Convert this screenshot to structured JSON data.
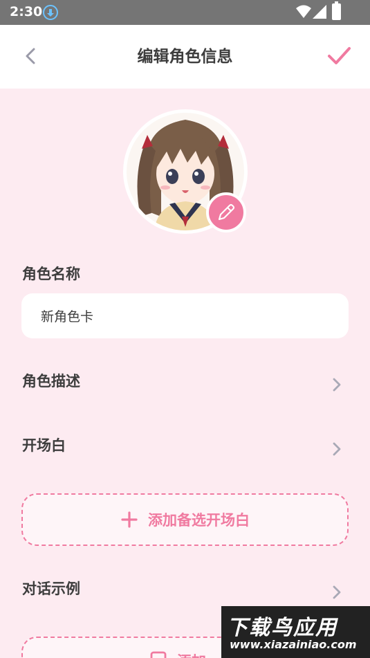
{
  "status_bar": {
    "time": "2:30"
  },
  "app_bar": {
    "title": "编辑角色信息"
  },
  "fields": {
    "name_label": "角色名称",
    "name_value": "新角色卡",
    "description_label": "角色描述",
    "opening_label": "开场白",
    "add_alternate_opening": "添加备选开场白",
    "dialogue_examples_label": "对话示例",
    "bottom_button_label": "添加…"
  },
  "watermark": {
    "title": "下载鸟应用",
    "url": "www.xiazainiao.com"
  },
  "colors": {
    "accent": "#f07aa0",
    "background": "#fdebf1",
    "text": "#3d3d3d"
  }
}
